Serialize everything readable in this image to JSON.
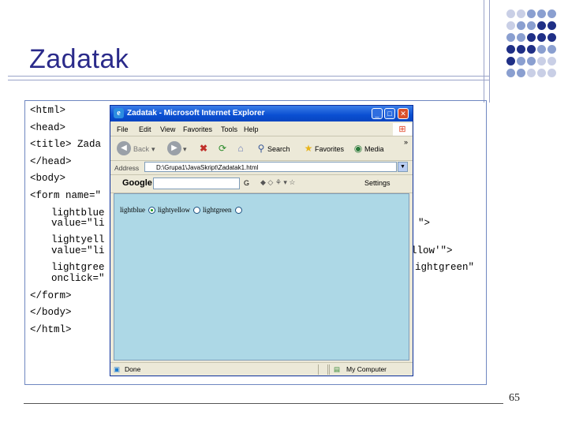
{
  "slide": {
    "title": "Zadatak",
    "page_number": "65"
  },
  "code": {
    "lines": [
      "<html>",
      "<head>",
      "<title> Zada",
      "</head>",
      "<body>",
      "<form name=\"",
      "lightblue",
      "value=\"li",
      "\">",
      "lightyell",
      "value=\"li",
      "llow'\">",
      "lightgree",
      "ightgreen\"",
      "onclick=\"",
      "</form>",
      "</body>",
      "</html>"
    ]
  },
  "browser": {
    "window_title": "Zadatak - Microsoft Internet Explorer",
    "title_icon": "e",
    "controls": {
      "minimize": "_",
      "maximize": "□",
      "close": "✕"
    },
    "menu": [
      "File",
      "Edit",
      "View",
      "Favorites",
      "Tools",
      "Help"
    ],
    "toolbar": {
      "back_label": "Back",
      "search_label": "Search",
      "favorites_label": "Favorites",
      "media_label": "Media",
      "overflow": "»"
    },
    "address": {
      "label": "Address",
      "value": "D:\\Grupa1\\JavaSkript\\Zadatak1.html",
      "dropdown": "▼"
    },
    "google": {
      "logo": "Google",
      "go_label": "G",
      "settings_label": "Settings"
    },
    "content": {
      "background_color": "#add8e6",
      "radios": [
        {
          "label": "lightblue",
          "checked": true
        },
        {
          "label": "lightyellow",
          "checked": false
        },
        {
          "label": "lightgreen",
          "checked": false
        }
      ]
    },
    "status": {
      "text": "Done",
      "zone": "My Computer"
    }
  },
  "colors": {
    "title": "#2a2a8a",
    "decoration": "#9aa3c8",
    "dots_dark": "#1f2f86",
    "dots_mid": "#8a9fd0"
  }
}
